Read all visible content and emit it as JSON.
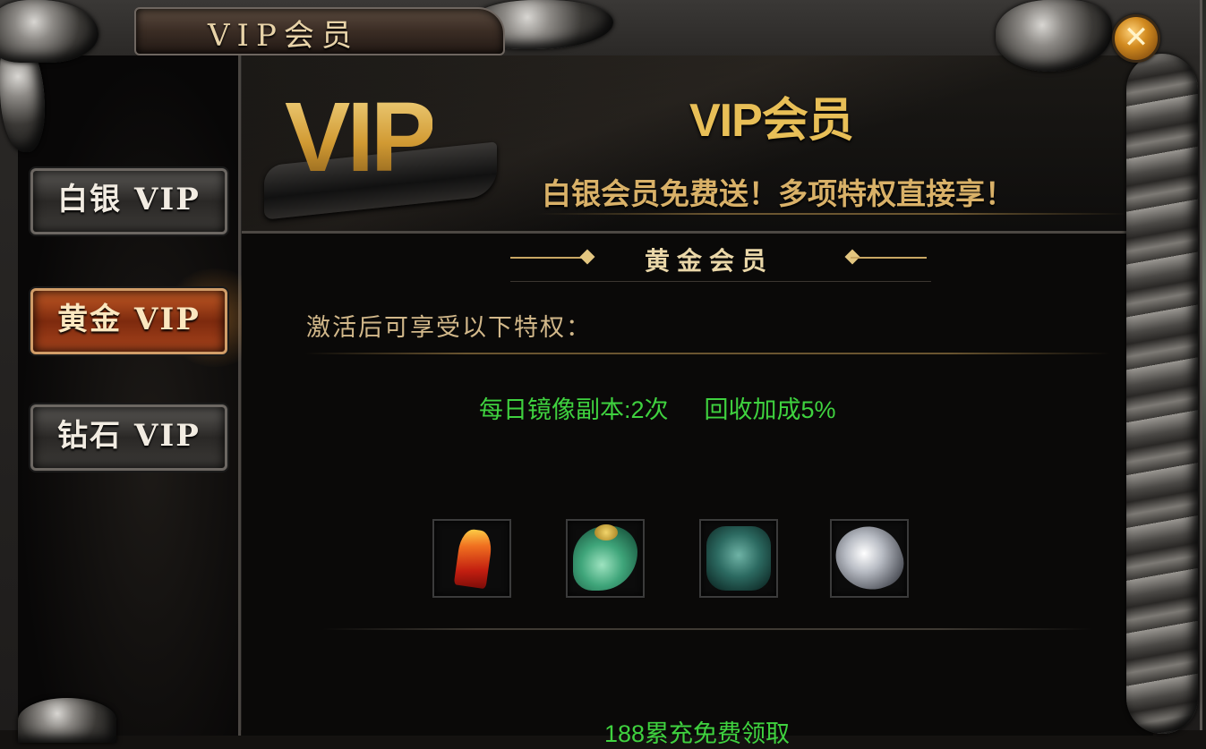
{
  "window": {
    "title": "VIP会员",
    "close_symbol": "✕"
  },
  "sidebar": {
    "tabs": [
      {
        "label": "白银 VIP",
        "active": false
      },
      {
        "label": "黄金 VIP",
        "active": true
      },
      {
        "label": "钻石 VIP",
        "active": false
      }
    ]
  },
  "banner": {
    "logo": "VIP",
    "title": "VIP会员",
    "subtitle": "白银会员免费送！多项特权直接享！"
  },
  "section": {
    "title": "黄金会员",
    "intro": "激活后可享受以下特权：",
    "perks": [
      "每日镜像副本:2次",
      "回收加成5%"
    ],
    "rewards": [
      {
        "icon": "red-talisman-icon"
      },
      {
        "icon": "jade-pendant-icon"
      },
      {
        "icon": "jade-mask-icon"
      },
      {
        "icon": "silver-armor-icon"
      }
    ],
    "bottom_text": "188累充免费领取"
  },
  "colors": {
    "accent_gold": "#e8bf57",
    "perk_green": "#3fd23f",
    "active_tab": "#a8441c"
  }
}
